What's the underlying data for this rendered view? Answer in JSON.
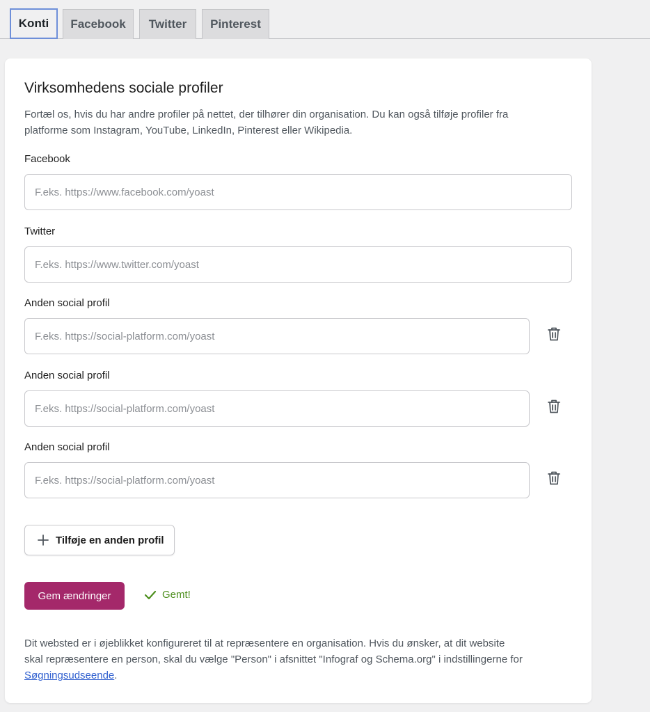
{
  "tabs": [
    {
      "label": "Konti",
      "active": true
    },
    {
      "label": "Facebook",
      "active": false
    },
    {
      "label": "Twitter",
      "active": false
    },
    {
      "label": "Pinterest",
      "active": false
    }
  ],
  "card": {
    "title": "Virksomhedens sociale profiler",
    "description": "Fortæl os, hvis du har andre profiler på nettet, der tilhører din organisation. Du kan også tilføje profiler fra platforme som Instagram, YouTube, LinkedIn, Pinterest eller Wikipedia.",
    "fields": [
      {
        "label": "Facebook",
        "placeholder": "F.eks. https://www.facebook.com/yoast",
        "value": ""
      },
      {
        "label": "Twitter",
        "placeholder": "F.eks. https://www.twitter.com/yoast",
        "value": ""
      },
      {
        "label": "Anden social profil",
        "placeholder": "F.eks. https://social-platform.com/yoast",
        "value": ""
      },
      {
        "label": "Anden social profil",
        "placeholder": "F.eks. https://social-platform.com/yoast",
        "value": ""
      },
      {
        "label": "Anden social profil",
        "placeholder": "F.eks. https://social-platform.com/yoast",
        "value": ""
      }
    ],
    "add_profile_label": "Tilføje en anden profil",
    "save_label": "Gem ændringer",
    "saved_label": "Gemt!",
    "footer_text_before": "Dit websted er i øjeblikket konfigureret til at repræsentere en organisation. Hvis du ønsker, at dit website skal repræsentere en person, skal du vælge \"Person\" i afsnittet \"Infograf og Schema.org\" i indstillingerne for ",
    "footer_link": "Søgningsudseende",
    "footer_text_after": "."
  },
  "colors": {
    "accent": "#a4286a",
    "success": "#4d8f1e",
    "link": "#2f5fcf",
    "active_tab_border": "#6e8fd9"
  },
  "icons": {
    "trash": "trash-icon",
    "plus": "plus-icon",
    "check": "check-icon"
  }
}
